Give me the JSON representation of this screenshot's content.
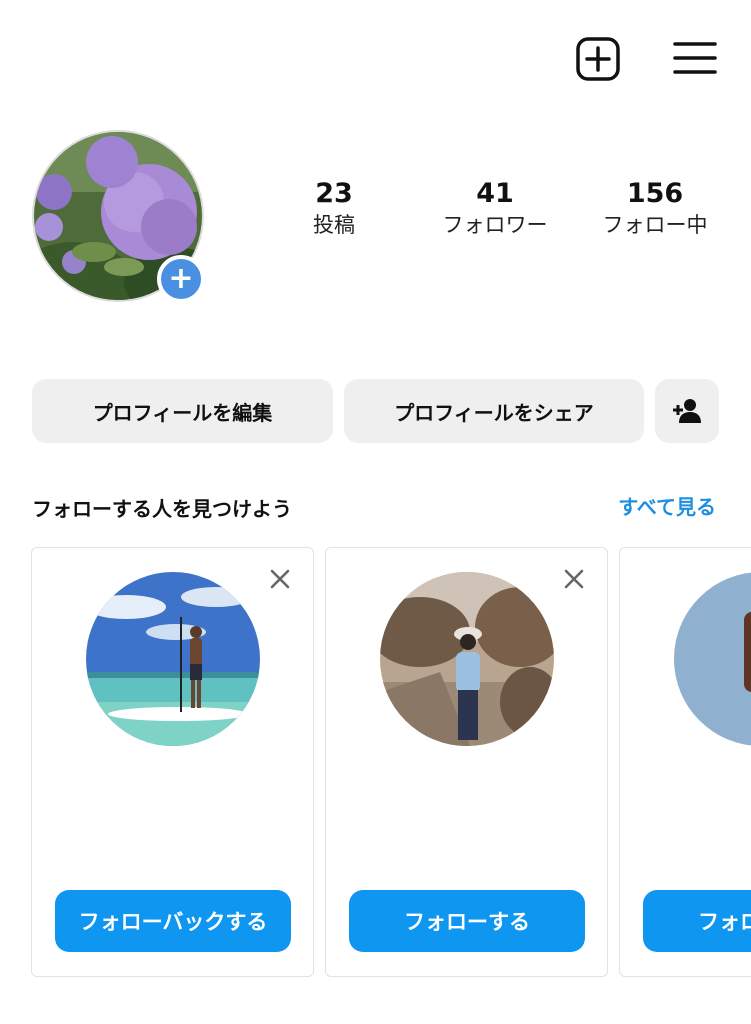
{
  "header": {
    "new_post_icon": "plus-square-icon",
    "menu_icon": "hamburger-menu-icon"
  },
  "profile": {
    "stats": [
      {
        "value": "23",
        "label": "投稿"
      },
      {
        "value": "41",
        "label": "フォロワー"
      },
      {
        "value": "156",
        "label": "フォロー中"
      }
    ],
    "edit_label": "プロフィールを編集",
    "share_label": "プロフィールをシェア",
    "add_user_icon": "add-person-icon",
    "avatar_add_icon": "plus-icon"
  },
  "suggestions": {
    "title": "フォローする人を見つけよう",
    "see_all": "すべて見る",
    "cards": [
      {
        "button": "フォローバックする"
      },
      {
        "button": "フォローする"
      },
      {
        "button": "フォローする"
      }
    ]
  },
  "colors": {
    "accent_blue": "#0f96f0",
    "link_blue": "#1e8fe0",
    "pill_gray": "#efefef"
  }
}
